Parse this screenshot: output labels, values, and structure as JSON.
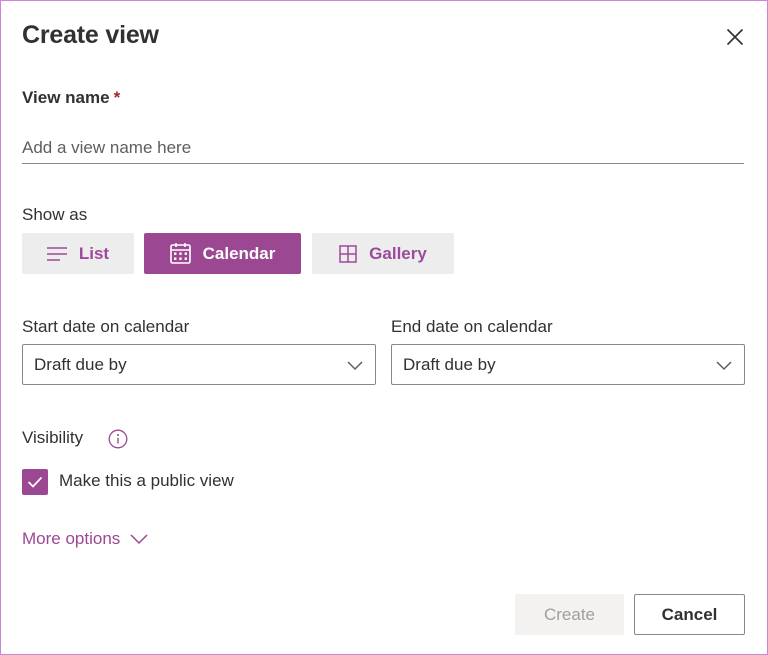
{
  "dialog": {
    "title": "Create view",
    "close_icon": "close-icon"
  },
  "view_name": {
    "label": "View name",
    "required_marker": "*",
    "value": "",
    "placeholder": "Add a view name here"
  },
  "show_as": {
    "label": "Show as",
    "selected": "Calendar",
    "options": [
      {
        "label": "List",
        "icon": "list-icon"
      },
      {
        "label": "Calendar",
        "icon": "calendar-icon"
      },
      {
        "label": "Gallery",
        "icon": "gallery-icon"
      }
    ]
  },
  "calendar_dates": {
    "start": {
      "label": "Start date on calendar",
      "value": "Draft due by"
    },
    "end": {
      "label": "End date on calendar",
      "value": "Draft due by"
    }
  },
  "visibility": {
    "label": "Visibility",
    "info_icon": "info-icon",
    "public_checkbox": {
      "label": "Make this a public view",
      "checked": true
    }
  },
  "more_options": {
    "label": "More options",
    "icon": "chevron-down-icon"
  },
  "footer": {
    "create_label": "Create",
    "create_enabled": false,
    "cancel_label": "Cancel"
  },
  "colors": {
    "accent": "#9b4791",
    "dialog_border": "#c987d6",
    "button_inactive_bg": "#ededed",
    "disabled_text": "#a19f9d"
  }
}
